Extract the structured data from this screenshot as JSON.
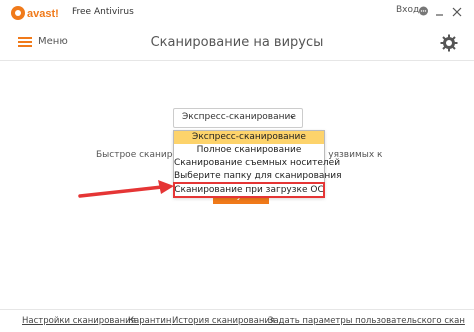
{
  "titlebar": {
    "brand": "avast!",
    "product": "Free Antivirus",
    "login": "Вход"
  },
  "header": {
    "menu_label": "Меню",
    "title": "Сканирование на вирусы"
  },
  "scan": {
    "selected": "Экспресс-сканирование",
    "description_left": "Быстрое сканиров",
    "description_right": "я уязвимых к",
    "start_label": "Пуск",
    "options": [
      "Экспресс-сканирование",
      "Полное сканирование",
      "Сканирование съемных носителей",
      "Выберите папку для сканирования",
      "Сканирование при загрузке ОС"
    ]
  },
  "footer": {
    "links": [
      "Настройки сканирования",
      "Карантин",
      "История сканирования",
      "Задать параметры пользовательского скан"
    ]
  },
  "colors": {
    "accent": "#f07a1a",
    "highlight": "#e53535",
    "selection": "#fdd36b"
  }
}
